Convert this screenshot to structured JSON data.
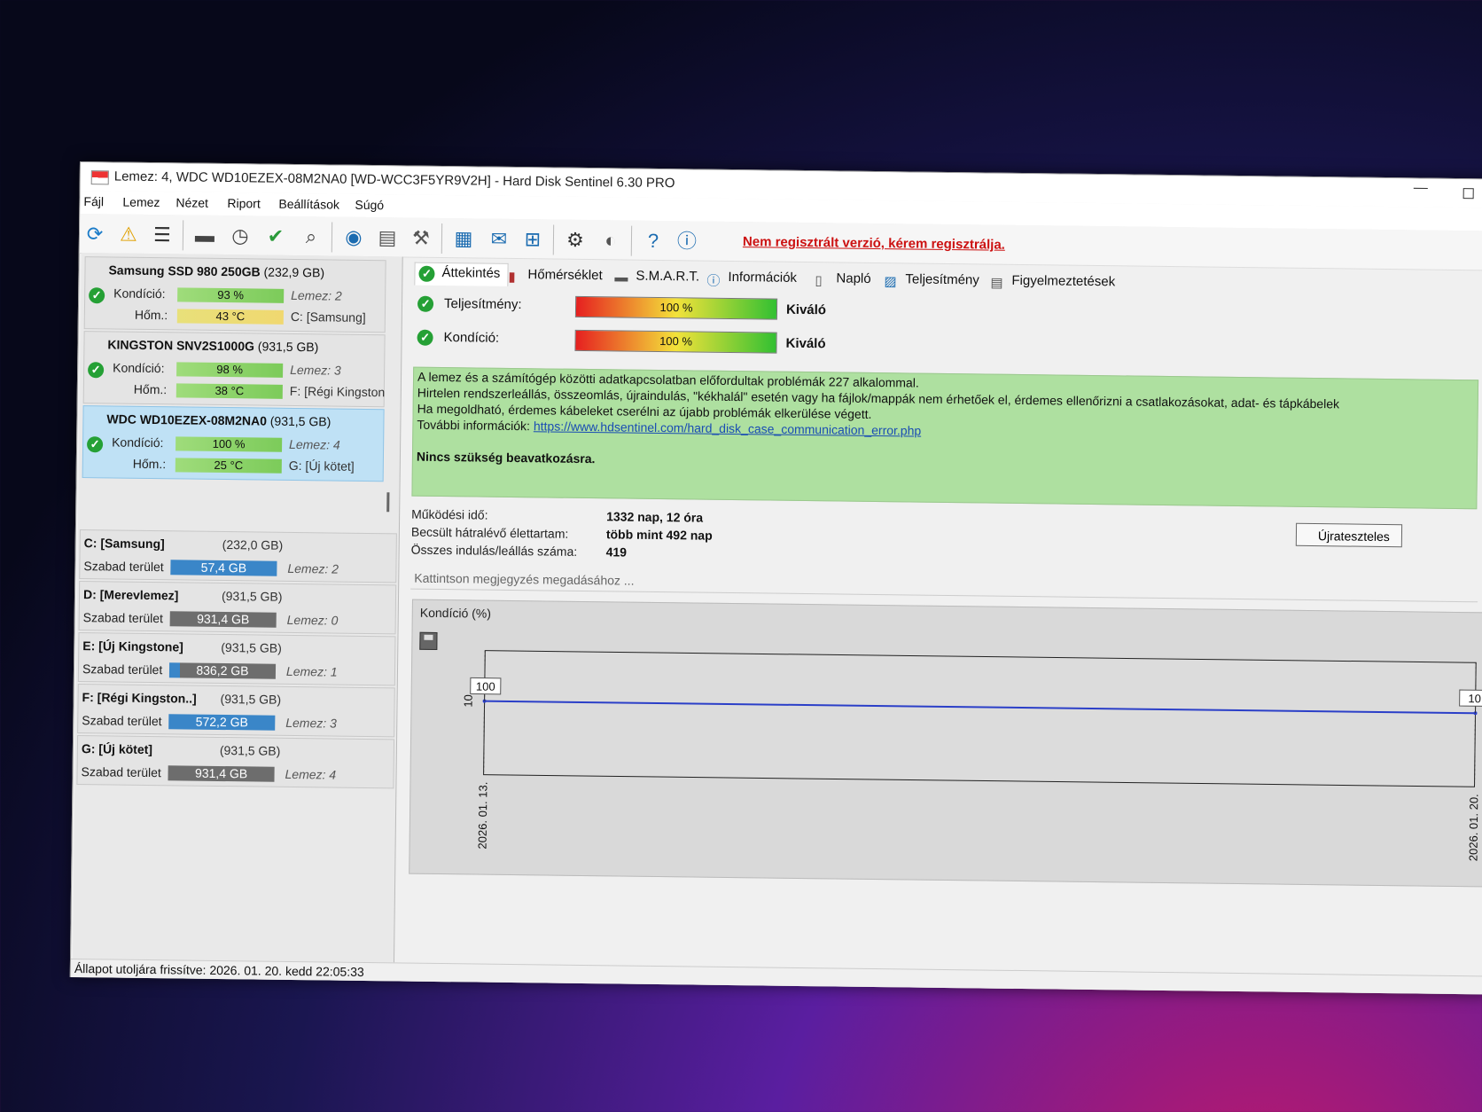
{
  "window": {
    "title": "Lemez: 4, WDC WD10EZEX-08M2NA0 [WD-WCC3F5YR9V2H]  -  Hard Disk Sentinel 6.30 PRO",
    "minimize": "—"
  },
  "menu": [
    "Fájl",
    "Lemez",
    "Nézet",
    "Riport",
    "Beállítások",
    "Súgó"
  ],
  "toolbar": {
    "icons": [
      "refresh-icon",
      "alert-refresh-icon",
      "list-icon",
      "disk-icon",
      "disk-clock-icon",
      "disk-check-icon",
      "disk-search-icon",
      "globe-icon",
      "layers-icon",
      "tools-icon",
      "report-icon",
      "mail-icon",
      "network-icon",
      "gear-icon",
      "sound-icon",
      "help-icon",
      "info-icon"
    ],
    "register_note": "Nem regisztrált verzió, kérem regisztrálja."
  },
  "disks": [
    {
      "name": "Samsung SSD 980 250GB",
      "size": "(232,9 GB)",
      "cond_label": "Kondíció:",
      "cond": "93 %",
      "cond_value": 93,
      "temp_label": "Hőm.:",
      "temp": "43 °C",
      "temp_color": "yellow",
      "disk_no": "Lemez: 2",
      "drive": "C: [Samsung]"
    },
    {
      "name": "KINGSTON SNV2S1000G",
      "size": "(931,5 GB)",
      "cond_label": "Kondíció:",
      "cond": "98 %",
      "cond_value": 98,
      "temp_label": "Hőm.:",
      "temp": "38 °C",
      "temp_color": "green",
      "disk_no": "Lemez: 3",
      "drive": "F: [Régi Kingston"
    },
    {
      "name": "WDC WD10EZEX-08M2NA0",
      "size": "(931,5 GB)",
      "cond_label": "Kondíció:",
      "cond": "100 %",
      "cond_value": 100,
      "temp_label": "Hőm.:",
      "temp": "25 °C",
      "temp_color": "green",
      "disk_no": "Lemez: 4",
      "drive": "G: [Új kötet]"
    }
  ],
  "volumes": [
    {
      "name": "C: [Samsung]",
      "size": "(232,0 GB)",
      "free_label": "Szabad terület",
      "free": "57,4 GB",
      "disk": "Lemez: 2",
      "color": "#3a86c8"
    },
    {
      "name": "D: [Merevlemez]",
      "size": "(931,5 GB)",
      "free_label": "Szabad terület",
      "free": "931,4 GB",
      "disk": "Lemez: 0",
      "color": "#6d6d6d"
    },
    {
      "name": "E: [Új Kingstone]",
      "size": "(931,5 GB)",
      "free_label": "Szabad terület",
      "free": "836,2 GB",
      "disk": "Lemez: 1",
      "color": "#5a6e80"
    },
    {
      "name": "F: [Régi Kingston..]",
      "size": "(931,5 GB)",
      "free_label": "Szabad terület",
      "free": "572,2 GB",
      "disk": "Lemez: 3",
      "color": "#3a86c8"
    },
    {
      "name": "G: [Új kötet]",
      "size": "(931,5 GB)",
      "free_label": "Szabad terület",
      "free": "931,4 GB",
      "disk": "Lemez: 4",
      "color": "#6d6d6d"
    }
  ],
  "tabs": [
    "Áttekintés",
    "Hőmérséklet",
    "S.M.A.R.T.",
    "Információk",
    "Napló",
    "Teljesítmény",
    "Figyelmeztetések"
  ],
  "overview": {
    "perf_label": "Teljesítmény:",
    "perf_value": "100 %",
    "perf_rating": "Kiváló",
    "cond_label": "Kondíció:",
    "cond_value": "100 %",
    "cond_rating": "Kiváló",
    "info_lines": [
      "A lemez és a számítógép közötti adatkapcsolatban előfordultak problémák 227 alkalommal.",
      "Hirtelen rendszerleállás, összeomlás, újraindulás, \"kékhalál\" esetén vagy ha fájlok/mappák nem érhetőek el, érdemes ellenőrizni a csatlakozásokat, adat- és tápkábelek",
      "Ha megoldható, érdemes kábeleket cserélni az újabb problémák elkerülése végett."
    ],
    "more_info_label": "További információk:",
    "more_info_link": "https://www.hdsentinel.com/hard_disk_case_communication_error.php",
    "action": "Nincs szükség beavatkozásra.",
    "uptime_label": "Működési idő:",
    "uptime": "1332 nap, 12 óra",
    "remaining_label": "Becsült hátralévő élettartam:",
    "remaining": "több mint 492 nap",
    "starts_label": "Összes indulás/leállás száma:",
    "starts": "419",
    "retest": "Újrateszteles",
    "note_placeholder": "Kattintson megjegyzés megadásához ..."
  },
  "chart_data": {
    "type": "line",
    "title": "Kondíció  (%)",
    "x": [
      "2026. 01. 13.",
      "2026. 01. 20."
    ],
    "series": [
      {
        "values": [
          100,
          100
        ]
      }
    ],
    "point_labels": [
      "100",
      "10"
    ],
    "y_tick": "10",
    "color": "#2b3fc8"
  },
  "statusbar": "Állapot utoljára frissítve: 2026. 01. 20. kedd 22:05:33"
}
